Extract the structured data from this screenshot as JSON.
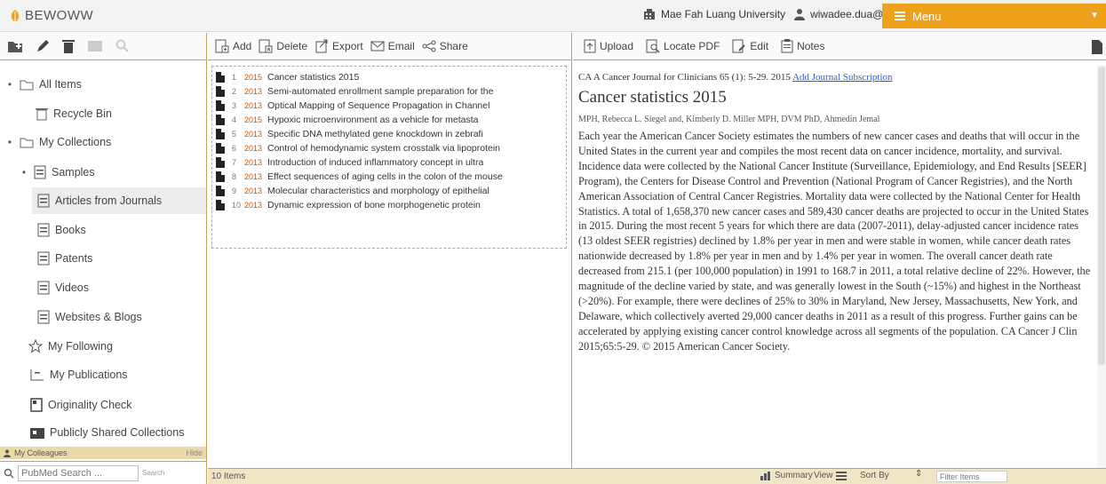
{
  "header": {
    "app_name": "BEWOWW",
    "institution": "Mae Fah Luang University",
    "user_email": "wiwadee.dua@mfu.ac.th",
    "menu_label": "Menu"
  },
  "colors": {
    "accent": "#eea21b",
    "border": "#c8a15a",
    "link": "#2a5bd7",
    "year": "#b65b0e"
  },
  "sidebar": {
    "items": [
      {
        "label": "All Items",
        "icon": "folder-icon"
      },
      {
        "label": "Recycle Bin",
        "icon": "trash-icon"
      },
      {
        "label": "My Collections",
        "icon": "folder-icon"
      },
      {
        "label": "Samples",
        "icon": "collection-icon"
      },
      {
        "label": "Articles from Journals",
        "icon": "collection-icon"
      },
      {
        "label": "Books",
        "icon": "collection-icon"
      },
      {
        "label": "Patents",
        "icon": "collection-icon"
      },
      {
        "label": "Videos",
        "icon": "collection-icon"
      },
      {
        "label": "Websites & Blogs",
        "icon": "collection-icon"
      },
      {
        "label": "My Following",
        "icon": "star-icon"
      },
      {
        "label": "My Publications",
        "icon": "publication-icon"
      },
      {
        "label": "Originality Check",
        "icon": "check-icon"
      },
      {
        "label": "Publicly Shared Collections",
        "icon": "shared-icon"
      }
    ],
    "footer_label": "My Colleagues",
    "footer_right": "Hide",
    "search_placeholder": "PubMed Search ...",
    "search_button": "Search"
  },
  "middle": {
    "toolbar": {
      "add": "Add",
      "delete": "Delete",
      "export": "Export",
      "email": "Email",
      "share": "Share"
    },
    "rows": [
      {
        "num": "1",
        "year": "2015",
        "title": "Cancer statistics 2015"
      },
      {
        "num": "2",
        "year": "2013",
        "title": "Semi-automated enrollment sample preparation for the"
      },
      {
        "num": "3",
        "year": "2013",
        "title": "Optical Mapping of Sequence Propagation in Channel"
      },
      {
        "num": "4",
        "year": "2015",
        "title": "Hypoxic microenvironment as a vehicle for metasta"
      },
      {
        "num": "5",
        "year": "2013",
        "title": "Specific DNA methylated gene knockdown in zebrafi"
      },
      {
        "num": "6",
        "year": "2013",
        "title": "Control of hemodynamic system crosstalk via lipoprotein"
      },
      {
        "num": "7",
        "year": "2013",
        "title": "Introduction of induced inflammatory concept in ultra"
      },
      {
        "num": "8",
        "year": "2013",
        "title": "Effect sequences of aging cells in the colon of the mouse"
      },
      {
        "num": "9",
        "year": "2013",
        "title": "Molecular characteristics and morphology of epithelial"
      },
      {
        "num": "10",
        "year": "2013",
        "title": "Dynamic expression of bone morphogenetic protein"
      }
    ],
    "items_count": "10 Items"
  },
  "right": {
    "toolbar": {
      "upload": "Upload",
      "locate": "Locate PDF",
      "edit": "Edit",
      "notes": "Notes"
    },
    "citation": "CA A Cancer Journal for Clinicians 65 (1): 5-29. 2015",
    "citation_link": "Add Journal Subscription",
    "title": "Cancer statistics 2015",
    "authors": "MPH, Rebecca L. Siegel and, Kimberly D. Miller MPH, DVM PhD, Ahmedin Jemal",
    "abstract": "Each year the American Cancer Society estimates the numbers of new cancer cases and deaths that will occur in the United States in the current year and compiles the most recent data on cancer incidence, mortality, and survival. Incidence data were collected by the National Cancer Institute (Surveillance, Epidemiology, and End Results [SEER] Program), the Centers for Disease Control and Prevention (National Program of Cancer Registries), and the North American Association of Central Cancer Registries. Mortality data were collected by the National Center for Health Statistics. A total of 1,658,370 new cancer cases and 589,430 cancer deaths are projected to occur in the United States in 2015. During the most recent 5 years for which there are data (2007-2011), delay-adjusted cancer incidence rates (13 oldest SEER registries) declined by 1.8% per year in men and were stable in women, while cancer death rates nationwide decreased by 1.8% per year in men and by 1.4% per year in women. The overall cancer death rate decreased from 215.1 (per 100,000 population) in 1991 to 168.7 in 2011, a total relative decline of 22%. However, the magnitude of the decline varied by state, and was generally lowest in the South (~15%) and highest in the Northeast (>20%). For example, there were declines of 25% to 30% in Maryland, New Jersey, Massachusetts, New York, and Delaware, which collectively averted 29,000 cancer deaths in 2011 as a result of this progress. Further gains can be accelerated by applying existing cancer control knowledge across all segments of the population. CA Cancer J Clin 2015;65:5-29. © 2015 American Cancer Society."
  },
  "bottom": {
    "summary_label": "Summary",
    "view_label": "View",
    "sort_label": "Sort By",
    "filter_placeholder": "Filter Items"
  }
}
